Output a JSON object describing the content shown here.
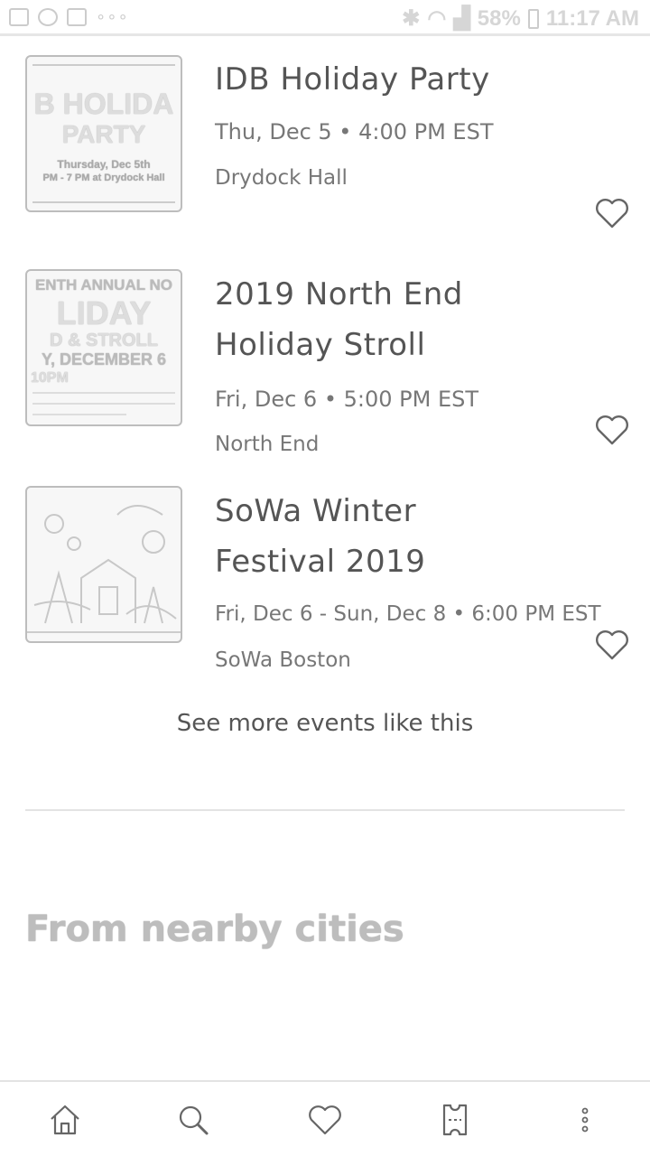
{
  "status_bar": {
    "battery": "58%",
    "time": "11:17 AM"
  },
  "events": [
    {
      "title_lines": [
        "IDB Holiday Party"
      ],
      "date": "Thu, Dec 5 • 4:00 PM EST",
      "venue": "Drydock Hall",
      "thumb_lines": [
        "B HOLIDA",
        "PARTY",
        "Thursday, Dec 5th",
        "PM - 7 PM at Drydock Hall"
      ]
    },
    {
      "title_lines": [
        "2019 North End",
        "Holiday Stroll"
      ],
      "date": "Fri, Dec 6 • 5:00 PM EST",
      "venue": "North End",
      "thumb_lines": [
        "ENTH ANNUAL NO",
        "LIDAY",
        "D & STROLL",
        "Y, DECEMBER 6",
        "10PM"
      ]
    },
    {
      "title_lines": [
        "SoWa Winter",
        "Festival 2019"
      ],
      "date": "Fri, Dec 6 - Sun, Dec 8 • 6:00 PM EST",
      "venue": "SoWa Boston",
      "thumb_lines": []
    }
  ],
  "see_more": "See more events like this",
  "section_title": "From nearby cities",
  "nav": {
    "home": "home-icon",
    "search": "search-icon",
    "likes": "heart-icon",
    "tickets": "ticket-icon",
    "more": "more-icon"
  }
}
